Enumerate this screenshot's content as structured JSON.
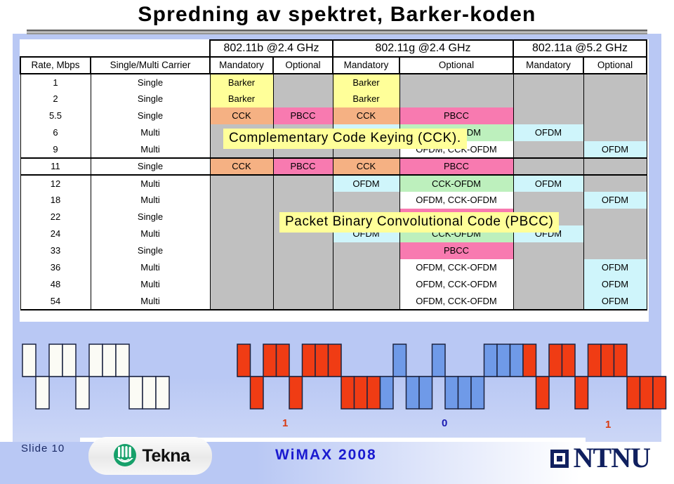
{
  "slide": {
    "title": "Spredning av spektret, Barker-koden",
    "slide_number_label": "Slide  10",
    "conference": "WiMAX 2008",
    "org_logo_text": "Tekna",
    "university_logo_text": "NTNU"
  },
  "table": {
    "groups": [
      {
        "label": "",
        "span": 2
      },
      {
        "label": "802.11b @2.4 GHz",
        "span": 2
      },
      {
        "label": "802.11g @2.4 GHz",
        "span": 2
      },
      {
        "label": "802.11a @5.2 GHz",
        "span": 2
      }
    ],
    "columns": [
      "Rate, Mbps",
      "Single/Multi Carrier",
      "Mandatory",
      "Optional",
      "Mandatory",
      "Optional",
      "Mandatory",
      "Optional"
    ],
    "rows": [
      {
        "rate": "1",
        "carrier": "Single",
        "b_mand": "Barker",
        "b_mand_fill": "yellow",
        "b_opt": "",
        "b_opt_fill": "gray",
        "g_mand": "Barker",
        "g_mand_fill": "yellow",
        "g_opt": "",
        "g_opt_fill": "gray",
        "a_mand": "",
        "a_mand_fill": "gray",
        "a_opt": "",
        "a_opt_fill": "gray",
        "highlight": false
      },
      {
        "rate": "2",
        "carrier": "Single",
        "b_mand": "Barker",
        "b_mand_fill": "yellow",
        "b_opt": "",
        "b_opt_fill": "gray",
        "g_mand": "Barker",
        "g_mand_fill": "yellow",
        "g_opt": "",
        "g_opt_fill": "gray",
        "a_mand": "",
        "a_mand_fill": "gray",
        "a_opt": "",
        "a_opt_fill": "gray",
        "highlight": false
      },
      {
        "rate": "5.5",
        "carrier": "Single",
        "b_mand": "CCK",
        "b_mand_fill": "orange",
        "b_opt": "PBCC",
        "b_opt_fill": "pink",
        "g_mand": "CCK",
        "g_mand_fill": "orange",
        "g_opt": "PBCC",
        "g_opt_fill": "pink",
        "a_mand": "",
        "a_mand_fill": "gray",
        "a_opt": "",
        "a_opt_fill": "gray",
        "highlight": false
      },
      {
        "rate": "6",
        "carrier": "Multi",
        "b_mand": "",
        "b_mand_fill": "gray",
        "b_opt": "",
        "b_opt_fill": "gray",
        "g_mand": "OFDM",
        "g_mand_fill": "cyan",
        "g_opt": "CCK-OFDM",
        "g_opt_fill": "green",
        "a_mand": "OFDM",
        "a_mand_fill": "cyan",
        "a_opt": "",
        "a_opt_fill": "gray",
        "highlight": false
      },
      {
        "rate": "9",
        "carrier": "Multi",
        "b_mand": "",
        "b_mand_fill": "gray",
        "b_opt": "",
        "b_opt_fill": "gray",
        "g_mand": "",
        "g_mand_fill": "gray",
        "g_opt": "OFDM, CCK-OFDM",
        "g_opt_fill": "white",
        "a_mand": "",
        "a_mand_fill": "gray",
        "a_opt": "OFDM",
        "a_opt_fill": "cyan",
        "highlight": false
      },
      {
        "rate": "11",
        "carrier": "Single",
        "b_mand": "CCK",
        "b_mand_fill": "orange",
        "b_opt": "PBCC",
        "b_opt_fill": "pink",
        "g_mand": "CCK",
        "g_mand_fill": "orange",
        "g_opt": "PBCC",
        "g_opt_fill": "pink",
        "a_mand": "",
        "a_mand_fill": "gray",
        "a_opt": "",
        "a_opt_fill": "gray",
        "highlight": true
      },
      {
        "rate": "12",
        "carrier": "Multi",
        "b_mand": "",
        "b_mand_fill": "gray",
        "b_opt": "",
        "b_opt_fill": "gray",
        "g_mand": "OFDM",
        "g_mand_fill": "cyan",
        "g_opt": "CCK-OFDM",
        "g_opt_fill": "green",
        "a_mand": "OFDM",
        "a_mand_fill": "cyan",
        "a_opt": "",
        "a_opt_fill": "gray",
        "highlight": false
      },
      {
        "rate": "18",
        "carrier": "Multi",
        "b_mand": "",
        "b_mand_fill": "gray",
        "b_opt": "",
        "b_opt_fill": "gray",
        "g_mand": "",
        "g_mand_fill": "gray",
        "g_opt": "OFDM, CCK-OFDM",
        "g_opt_fill": "white",
        "a_mand": "",
        "a_mand_fill": "gray",
        "a_opt": "OFDM",
        "a_opt_fill": "cyan",
        "highlight": false
      },
      {
        "rate": "22",
        "carrier": "Single",
        "b_mand": "",
        "b_mand_fill": "gray",
        "b_opt": "",
        "b_opt_fill": "gray",
        "g_mand": "",
        "g_mand_fill": "gray",
        "g_opt": "PBCC",
        "g_opt_fill": "pink",
        "a_mand": "",
        "a_mand_fill": "gray",
        "a_opt": "",
        "a_opt_fill": "gray",
        "highlight": false
      },
      {
        "rate": "24",
        "carrier": "Multi",
        "b_mand": "",
        "b_mand_fill": "gray",
        "b_opt": "",
        "b_opt_fill": "gray",
        "g_mand": "OFDM",
        "g_mand_fill": "cyan",
        "g_opt": "CCK-OFDM",
        "g_opt_fill": "green",
        "a_mand": "OFDM",
        "a_mand_fill": "cyan",
        "a_opt": "",
        "a_opt_fill": "gray",
        "highlight": false
      },
      {
        "rate": "33",
        "carrier": "Single",
        "b_mand": "",
        "b_mand_fill": "gray",
        "b_opt": "",
        "b_opt_fill": "gray",
        "g_mand": "",
        "g_mand_fill": "gray",
        "g_opt": "PBCC",
        "g_opt_fill": "pink",
        "a_mand": "",
        "a_mand_fill": "gray",
        "a_opt": "",
        "a_opt_fill": "gray",
        "highlight": false
      },
      {
        "rate": "36",
        "carrier": "Multi",
        "b_mand": "",
        "b_mand_fill": "gray",
        "b_opt": "",
        "b_opt_fill": "gray",
        "g_mand": "",
        "g_mand_fill": "gray",
        "g_opt": "OFDM, CCK-OFDM",
        "g_opt_fill": "white",
        "a_mand": "",
        "a_mand_fill": "gray",
        "a_opt": "OFDM",
        "a_opt_fill": "cyan",
        "highlight": false
      },
      {
        "rate": "48",
        "carrier": "Multi",
        "b_mand": "",
        "b_mand_fill": "gray",
        "b_opt": "",
        "b_opt_fill": "gray",
        "g_mand": "",
        "g_mand_fill": "gray",
        "g_opt": "OFDM, CCK-OFDM",
        "g_opt_fill": "white",
        "a_mand": "",
        "a_mand_fill": "gray",
        "a_opt": "OFDM",
        "a_opt_fill": "cyan",
        "highlight": false
      },
      {
        "rate": "54",
        "carrier": "Multi",
        "b_mand": "",
        "b_mand_fill": "gray",
        "b_opt": "",
        "b_opt_fill": "gray",
        "g_mand": "",
        "g_mand_fill": "gray",
        "g_opt": "OFDM, CCK-OFDM",
        "g_opt_fill": "white",
        "a_mand": "",
        "a_mand_fill": "gray",
        "a_opt": "OFDM",
        "a_opt_fill": "cyan",
        "highlight": false
      }
    ]
  },
  "callouts": {
    "cck": "Complementary Code Keying (CCK).",
    "pbcc": "Packet Binary Convolutional Code (PBCC)"
  },
  "waveform": {
    "barker_chips": [
      1,
      -1,
      1,
      1,
      -1,
      1,
      1,
      1,
      -1,
      -1,
      -1
    ],
    "bit_labels": [
      {
        "text": "1",
        "color": "#d93a10"
      },
      {
        "text": "0",
        "color": "#1a1ab0"
      },
      {
        "text": "1",
        "color": "#d93a10"
      }
    ],
    "colors": {
      "one_bit": "#f03c14",
      "zero_bit": "#6f9ae8",
      "plain": "#fbfbf5",
      "outline": "#1b2340",
      "background": "#b9c8f4"
    }
  }
}
